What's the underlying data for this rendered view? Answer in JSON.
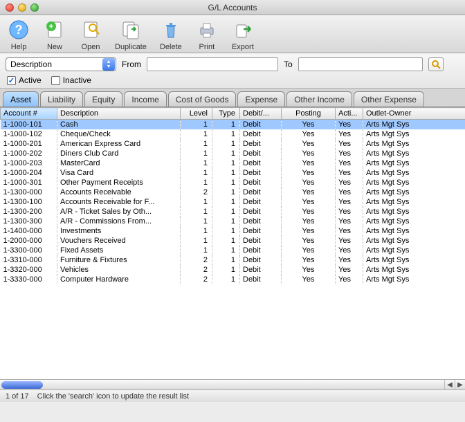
{
  "window": {
    "title": "G/L Accounts"
  },
  "toolbar": [
    {
      "name": "help",
      "label": "Help"
    },
    {
      "name": "new",
      "label": "New"
    },
    {
      "name": "open",
      "label": "Open"
    },
    {
      "name": "duplicate",
      "label": "Duplicate"
    },
    {
      "name": "delete",
      "label": "Delete"
    },
    {
      "name": "print",
      "label": "Print"
    },
    {
      "name": "export",
      "label": "Export"
    }
  ],
  "filter": {
    "combo_label": "Description",
    "from_label": "From",
    "to_label": "To",
    "from_value": "",
    "to_value": "",
    "active_label": "Active",
    "active_checked": true,
    "inactive_label": "Inactive",
    "inactive_checked": false
  },
  "tabs": [
    {
      "label": "Asset",
      "active": true
    },
    {
      "label": "Liability",
      "active": false
    },
    {
      "label": "Equity",
      "active": false
    },
    {
      "label": "Income",
      "active": false
    },
    {
      "label": "Cost of Goods",
      "active": false
    },
    {
      "label": "Expense",
      "active": false
    },
    {
      "label": "Other Income",
      "active": false
    },
    {
      "label": "Other Expense",
      "active": false
    }
  ],
  "columns": {
    "account": "Account #",
    "description": "Description",
    "level": "Level",
    "type": "Type",
    "debit": "Debit/...",
    "posting": "Posting",
    "active": "Acti...",
    "owner": "Outlet-Owner"
  },
  "rows": [
    {
      "account": "1-1000-101",
      "description": "Cash",
      "level": 1,
      "type": 1,
      "debit": "Debit",
      "posting": "Yes",
      "active": "Yes",
      "owner": "Arts Mgt Sys",
      "selected": true
    },
    {
      "account": "1-1000-102",
      "description": "Cheque/Check",
      "level": 1,
      "type": 1,
      "debit": "Debit",
      "posting": "Yes",
      "active": "Yes",
      "owner": "Arts Mgt Sys"
    },
    {
      "account": "1-1000-201",
      "description": "American Express Card",
      "level": 1,
      "type": 1,
      "debit": "Debit",
      "posting": "Yes",
      "active": "Yes",
      "owner": "Arts Mgt Sys"
    },
    {
      "account": "1-1000-202",
      "description": "Diners Club Card",
      "level": 1,
      "type": 1,
      "debit": "Debit",
      "posting": "Yes",
      "active": "Yes",
      "owner": "Arts Mgt Sys"
    },
    {
      "account": "1-1000-203",
      "description": "MasterCard",
      "level": 1,
      "type": 1,
      "debit": "Debit",
      "posting": "Yes",
      "active": "Yes",
      "owner": "Arts Mgt Sys"
    },
    {
      "account": "1-1000-204",
      "description": "Visa Card",
      "level": 1,
      "type": 1,
      "debit": "Debit",
      "posting": "Yes",
      "active": "Yes",
      "owner": "Arts Mgt Sys"
    },
    {
      "account": "1-1000-301",
      "description": "Other Payment Receipts",
      "level": 1,
      "type": 1,
      "debit": "Debit",
      "posting": "Yes",
      "active": "Yes",
      "owner": "Arts Mgt Sys"
    },
    {
      "account": "1-1300-000",
      "description": "Accounts Receivable",
      "level": 2,
      "type": 1,
      "debit": "Debit",
      "posting": "Yes",
      "active": "Yes",
      "owner": "Arts Mgt Sys"
    },
    {
      "account": "1-1300-100",
      "description": "Accounts Receivable for F...",
      "level": 1,
      "type": 1,
      "debit": "Debit",
      "posting": "Yes",
      "active": "Yes",
      "owner": "Arts Mgt Sys"
    },
    {
      "account": "1-1300-200",
      "description": "A/R - Ticket Sales by Oth...",
      "level": 1,
      "type": 1,
      "debit": "Debit",
      "posting": "Yes",
      "active": "Yes",
      "owner": "Arts Mgt Sys"
    },
    {
      "account": "1-1300-300",
      "description": "A/R - Commissions From...",
      "level": 1,
      "type": 1,
      "debit": "Debit",
      "posting": "Yes",
      "active": "Yes",
      "owner": "Arts Mgt Sys"
    },
    {
      "account": "1-1400-000",
      "description": "Investments",
      "level": 1,
      "type": 1,
      "debit": "Debit",
      "posting": "Yes",
      "active": "Yes",
      "owner": "Arts Mgt Sys"
    },
    {
      "account": "1-2000-000",
      "description": "Vouchers Received",
      "level": 1,
      "type": 1,
      "debit": "Debit",
      "posting": "Yes",
      "active": "Yes",
      "owner": "Arts Mgt Sys"
    },
    {
      "account": "1-3300-000",
      "description": "Fixed Assets",
      "level": 1,
      "type": 1,
      "debit": "Debit",
      "posting": "Yes",
      "active": "Yes",
      "owner": "Arts Mgt Sys"
    },
    {
      "account": "1-3310-000",
      "description": "Furniture & Fixtures",
      "level": 2,
      "type": 1,
      "debit": "Debit",
      "posting": "Yes",
      "active": "Yes",
      "owner": "Arts Mgt Sys"
    },
    {
      "account": "1-3320-000",
      "description": "Vehicles",
      "level": 2,
      "type": 1,
      "debit": "Debit",
      "posting": "Yes",
      "active": "Yes",
      "owner": "Arts Mgt Sys"
    },
    {
      "account": "1-3330-000",
      "description": "Computer Hardware",
      "level": 2,
      "type": 1,
      "debit": "Debit",
      "posting": "Yes",
      "active": "Yes",
      "owner": "Arts Mgt Sys"
    }
  ],
  "status": {
    "count": "1 of 17",
    "hint": "Click the 'search' icon to update the result list"
  }
}
